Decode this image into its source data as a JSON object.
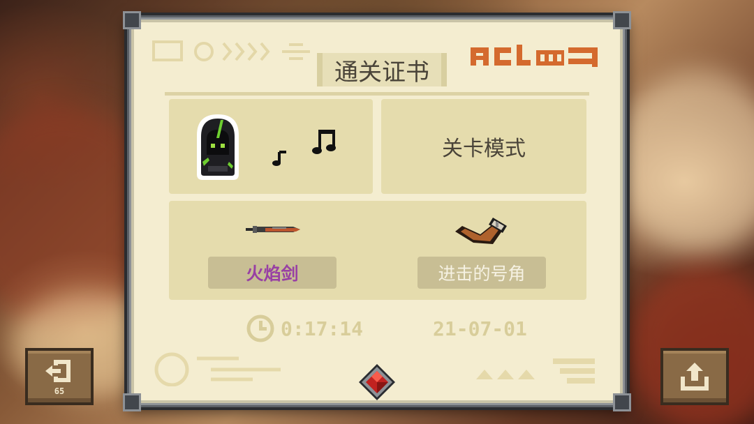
{
  "certificate": {
    "title": "通关证书",
    "mode": "关卡模式",
    "weapon": {
      "name": "火焰剑",
      "name_color": "#9b3fa8",
      "icon": "flame-sword-icon"
    },
    "relic": {
      "name": "进击的号角",
      "icon": "war-horn-icon"
    },
    "time": "0:17:14",
    "date": "21-07-01",
    "character_icon": "hooded-rogue-icon",
    "music_icon": "music-notes-icon",
    "gem_icon": "red-gem-icon",
    "stamp_color": "#d9692a"
  },
  "buttons": {
    "exit": {
      "icon": "exit-door-icon",
      "countdown": "65"
    },
    "share": {
      "icon": "share-icon"
    }
  }
}
